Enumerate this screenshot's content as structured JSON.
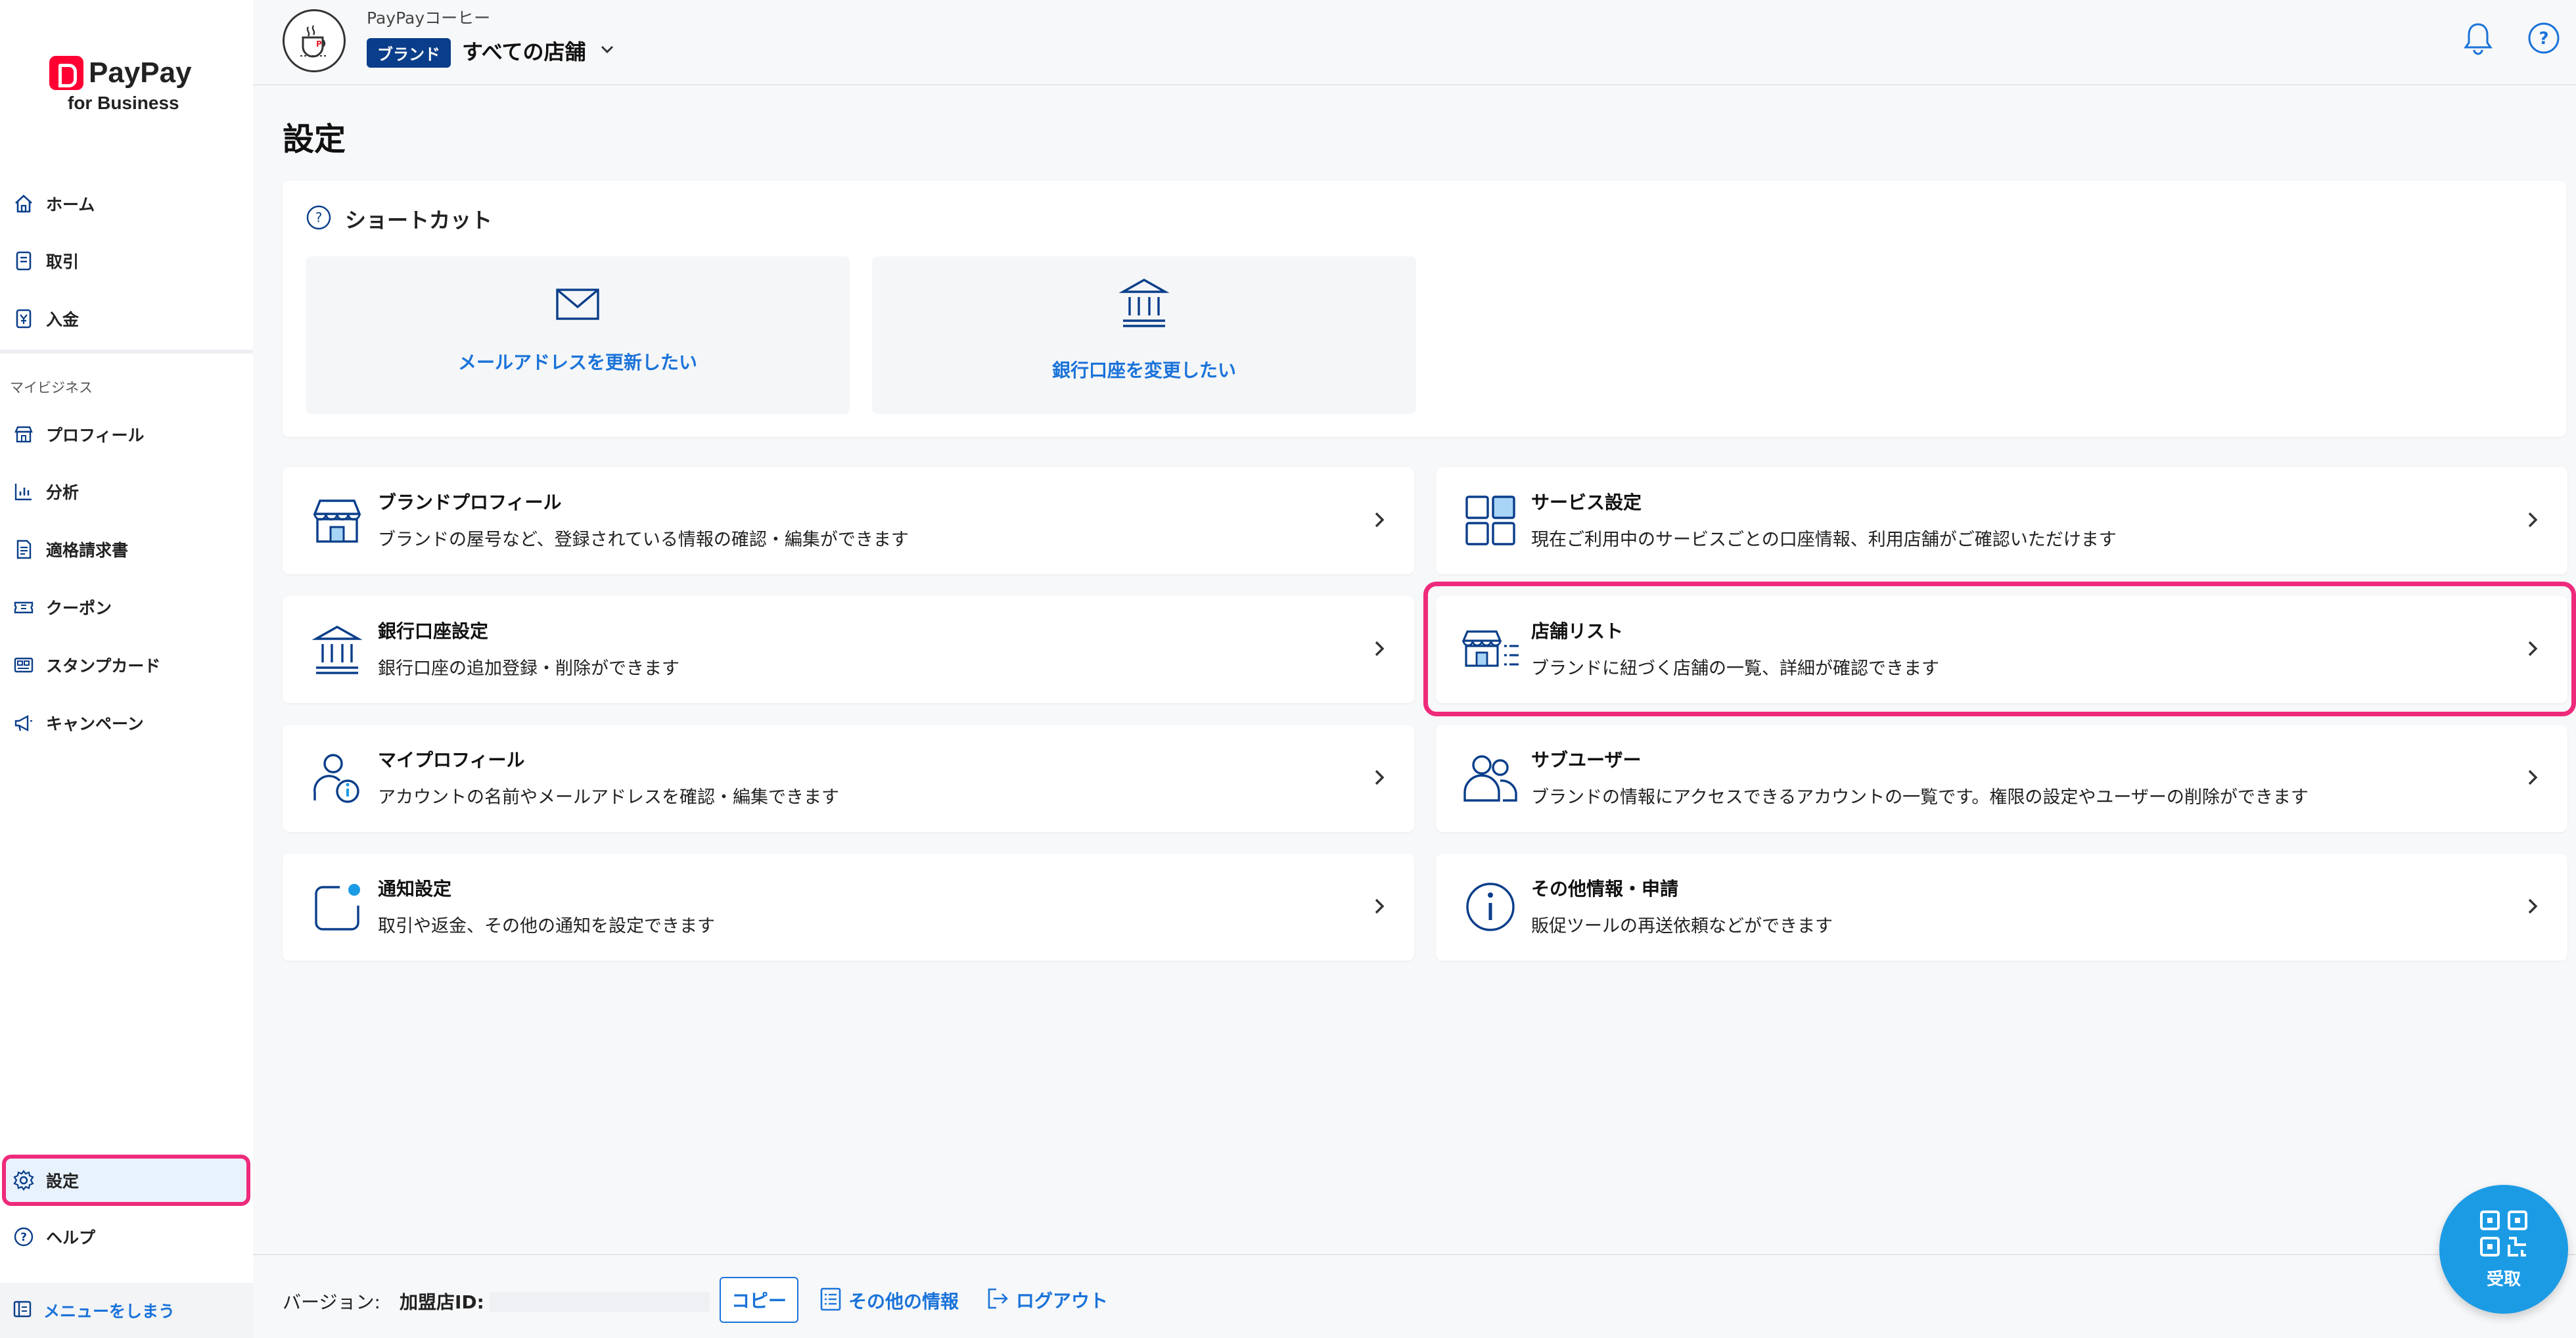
{
  "brand": {
    "name": "PayPay",
    "sub": "for Business"
  },
  "colors": {
    "accent": "#1a73d9",
    "brand_red": "#ff0033",
    "highlight": "#ee2a7b",
    "badge": "#0a3e8a",
    "receive": "#1c9be5"
  },
  "sidebar": {
    "items": [
      {
        "label": "ホーム",
        "icon": "home-icon"
      },
      {
        "label": "取引",
        "icon": "transaction-icon"
      },
      {
        "label": "入金",
        "icon": "deposit-icon"
      }
    ],
    "section_label": "マイビジネス",
    "business_items": [
      {
        "label": "プロフィール",
        "icon": "store-icon"
      },
      {
        "label": "分析",
        "icon": "chart-icon"
      },
      {
        "label": "適格請求書",
        "icon": "invoice-icon"
      },
      {
        "label": "クーポン",
        "icon": "coupon-icon"
      },
      {
        "label": "スタンプカード",
        "icon": "stamp-card-icon"
      },
      {
        "label": "キャンペーン",
        "icon": "megaphone-icon"
      }
    ],
    "bottom_items": [
      {
        "label": "設定",
        "icon": "gear-icon",
        "active": true
      },
      {
        "label": "ヘルプ",
        "icon": "help-icon"
      }
    ],
    "collapse_label": "メニューをしまう"
  },
  "header": {
    "store_name": "PayPayコーヒー",
    "badge": "ブランド",
    "store_select": "すべての店舗"
  },
  "page": {
    "title": "設定"
  },
  "shortcut": {
    "title": "ショートカット",
    "tiles": [
      {
        "label": "メールアドレスを更新したい",
        "icon": "mail-icon"
      },
      {
        "label": "銀行口座を変更したい",
        "icon": "bank-icon"
      }
    ]
  },
  "settings": {
    "left": [
      {
        "title": "ブランドプロフィール",
        "desc": "ブランドの屋号など、登録されている情報の確認・編集ができます",
        "icon": "store-icon"
      },
      {
        "title": "銀行口座設定",
        "desc": "銀行口座の追加登録・削除ができます",
        "icon": "bank-icon"
      },
      {
        "title": "マイプロフィール",
        "desc": "アカウントの名前やメールアドレスを確認・編集できます",
        "icon": "user-info-icon"
      },
      {
        "title": "通知設定",
        "desc": "取引や返金、その他の通知を設定できます",
        "icon": "notification-icon"
      }
    ],
    "right": [
      {
        "title": "サービス設定",
        "desc": "現在ご利用中のサービスごとの口座情報、利用店舗がご確認いただけます",
        "icon": "grid-icon"
      },
      {
        "title": "店舗リスト",
        "desc": "ブランドに紐づく店舗の一覧、詳細が確認できます",
        "icon": "store-list-icon",
        "highlighted": true
      },
      {
        "title": "サブユーザー",
        "desc": "ブランドの情報にアクセスできるアカウントの一覧です。権限の設定やユーザーの削除ができます",
        "icon": "users-icon"
      },
      {
        "title": "その他情報・申請",
        "desc": "販促ツールの再送依頼などができます",
        "icon": "info-icon"
      }
    ]
  },
  "footer": {
    "version_label": "バージョン:",
    "merchant_id_label": "加盟店ID:",
    "copy_label": "コピー",
    "other_info_label": "その他の情報",
    "logout_label": "ログアウト"
  },
  "receive": {
    "label": "受取"
  }
}
